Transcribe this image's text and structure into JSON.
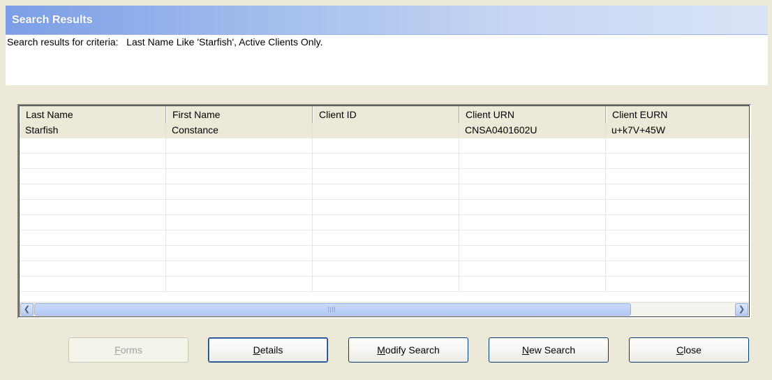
{
  "window": {
    "title": "Search Results"
  },
  "criteria": {
    "text": "Search results for criteria:   Last Name Like 'Starfish', Active Clients Only."
  },
  "table": {
    "columns": [
      "Last Name",
      "First Name",
      "Client ID",
      "Client URN",
      "Client EURN"
    ],
    "rows": [
      [
        "Starfish",
        "Constance",
        "",
        "CNSA0401602U",
        "u+k7V+45W"
      ]
    ]
  },
  "scrollbar": {
    "left_icon": "scroll-left-arrow-icon",
    "right_icon": "scroll-right-arrow-icon"
  },
  "buttons": {
    "forms": {
      "label": "Forms",
      "key": "F",
      "rest": "orms",
      "enabled": false
    },
    "details": {
      "label": "Details",
      "key": "D",
      "rest": "etails"
    },
    "modify_search": {
      "label": "Modify Search",
      "key": "M",
      "rest": "odify Search"
    },
    "new_search": {
      "label": "New Search",
      "key": "N",
      "rest": "ew Search"
    },
    "close": {
      "label": "Close",
      "key": "C",
      "rest": "lose"
    }
  },
  "colors": {
    "titlebar_start": "#7b9ee6",
    "dialog_bg": "#ece9d8",
    "button_border": "#003c74"
  }
}
